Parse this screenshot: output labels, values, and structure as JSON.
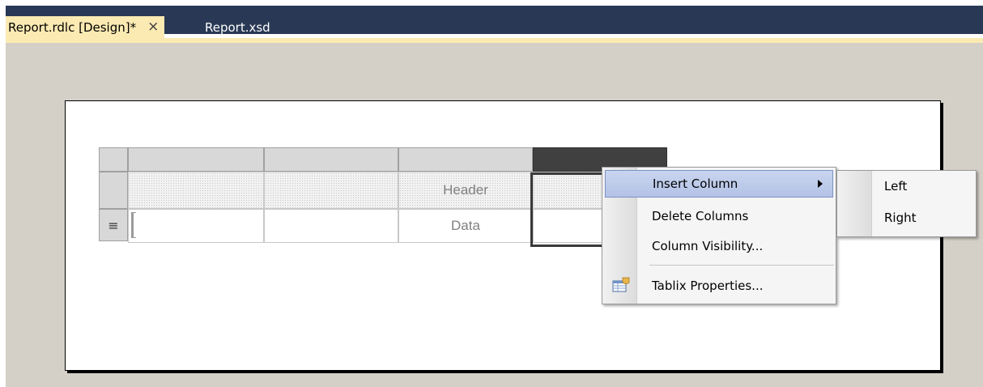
{
  "tabs": {
    "active_label": "Report.rdlc [Design]*",
    "active_close": "×",
    "second_label": "Report.xsd"
  },
  "tablix": {
    "header_text": "Header",
    "data_text": "Data",
    "row_menu_glyph": "≡"
  },
  "context_menu": {
    "items": [
      {
        "label": "Insert Column",
        "has_submenu": true,
        "highlighted": true
      },
      {
        "label": "Delete Columns"
      },
      {
        "label": "Column Visibility..."
      },
      {
        "label": "Tablix Properties...",
        "icon": "tablix-properties-icon"
      }
    ]
  },
  "submenu": {
    "items": [
      {
        "label": "Left"
      },
      {
        "label": "Right"
      }
    ]
  },
  "colors": {
    "titlebar": "#293955",
    "active_tab": "#fbeab2",
    "workspace": "#d4d0c8",
    "menu_highlight": "#b3c2e6"
  }
}
